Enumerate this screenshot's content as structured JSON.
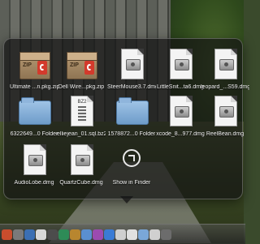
{
  "stack": {
    "items": [
      {
        "label": "Ultimate ...n.pkg.zip",
        "icon": "zip-archive-icon"
      },
      {
        "label": "Dell Wire...pkg.zip",
        "icon": "zip-archive-icon"
      },
      {
        "label": "SteerMouse3.7.dmg",
        "icon": "disk-image-icon"
      },
      {
        "label": "LittleSnit...ta6.dmg",
        "icon": "disk-image-icon"
      },
      {
        "label": "leopard_...S59.dmg",
        "icon": "disk-image-icon"
      },
      {
        "label": "6322649...0 Folder",
        "icon": "folder-icon"
      },
      {
        "label": "elliejean_01.sql.bz2",
        "icon": "bz2-document-icon",
        "badge": "BZ2"
      },
      {
        "label": "1578872...0 Folder",
        "icon": "folder-icon"
      },
      {
        "label": "xcode_8...977.dmg",
        "icon": "disk-image-icon"
      },
      {
        "label": "ReelBean.dmg",
        "icon": "disk-image-icon"
      },
      {
        "label": "AudioLobe.dmg",
        "icon": "disk-image-icon"
      },
      {
        "label": "QuartzCube.dmg",
        "icon": "disk-image-icon"
      },
      {
        "label": "Show in Finder",
        "icon": "show-in-finder-icon"
      }
    ]
  },
  "dock": {
    "icons": [
      "#c94d2d",
      "#7a7a7a",
      "#3b6fb3",
      "#d8d8d8",
      "#4c4c4c",
      "#2e8b57",
      "#b8862f",
      "#5a8fd0",
      "#9c4bb0",
      "#3a7bd5",
      "#cfcfcf",
      "#e0e0e0",
      "#7aa7d8",
      "#d0d0d0",
      "#6c6c6c"
    ]
  }
}
